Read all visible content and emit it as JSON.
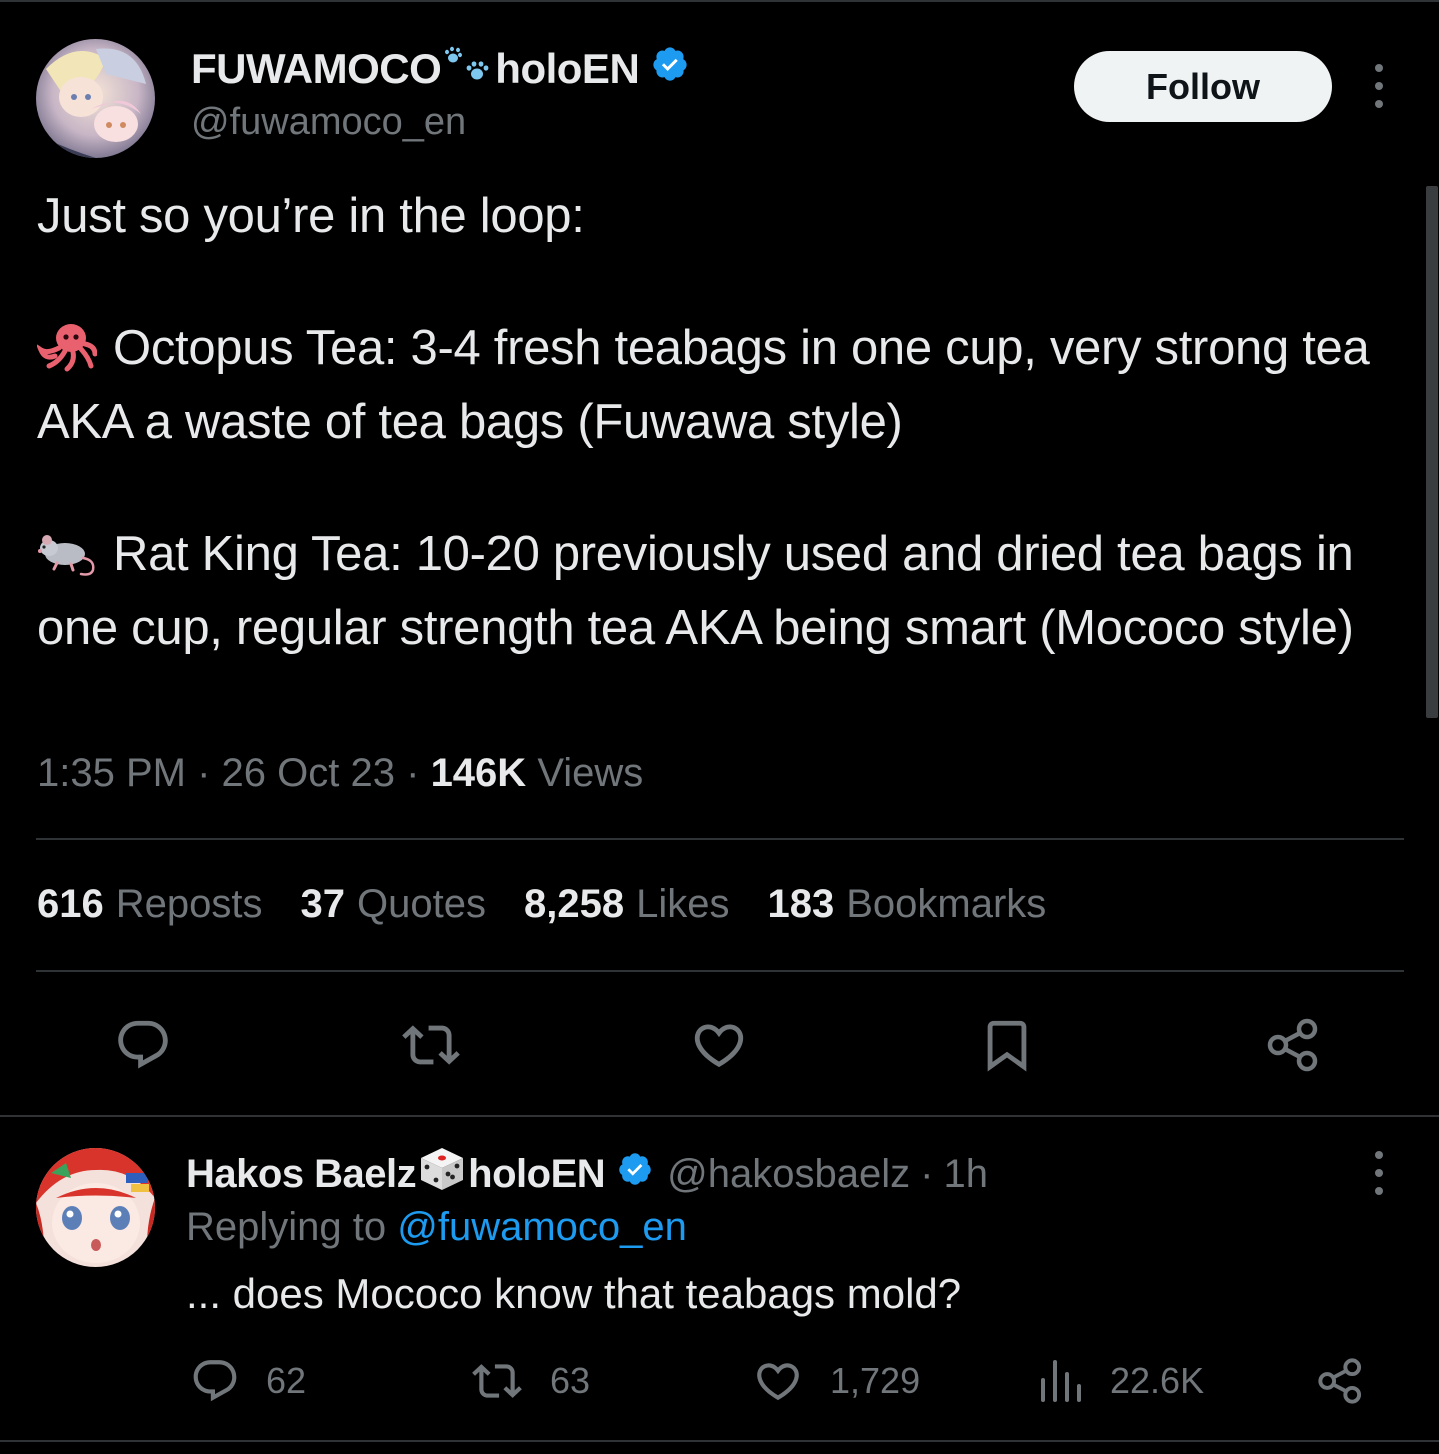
{
  "main_tweet": {
    "author": {
      "display_name_prefix": "FUWAMOCO",
      "display_name_suffix": "holoEN",
      "name_emoji": "paw-prints",
      "handle": "@fuwamoco_en",
      "verified": true
    },
    "follow_label": "Follow",
    "text": {
      "intro": "Just so you’re in the loop:",
      "octopus_line": "Octopus Tea: 3-4 fresh teabags in one cup, very strong tea AKA a waste of tea bags (Fuwawa style)",
      "rat_line": "Rat King Tea: 10-20 previously used and dried tea bags in one cup, regular strength tea AKA being smart (Mococo style)"
    },
    "meta": {
      "time": "1:35 PM",
      "sep": "·",
      "date": "26 Oct 23",
      "views_count": "146K",
      "views_label": "Views"
    },
    "stats": {
      "reposts_count": "616",
      "reposts_label": "Reposts",
      "quotes_count": "37",
      "quotes_label": "Quotes",
      "likes_count": "8,258",
      "likes_label": "Likes",
      "bookmarks_count": "183",
      "bookmarks_label": "Bookmarks"
    },
    "actions": [
      "reply-icon",
      "repost-icon",
      "like-icon",
      "bookmark-icon",
      "share-icon"
    ]
  },
  "reply": {
    "display_name_prefix": "Hakos Baelz",
    "display_name_suffix": "holoEN",
    "name_emoji": "dice",
    "handle": "@hakosbaelz",
    "sep": "·",
    "age": "1h",
    "replying_label": "Replying to",
    "replying_to": "@fuwamoco_en",
    "text": "... does Mococo know that teabags mold?",
    "stats": {
      "replies": "62",
      "reposts": "63",
      "likes": "1,729",
      "views": "22.6K"
    }
  },
  "colors": {
    "background": "#000000",
    "text_primary": "#e7e9ea",
    "text_secondary": "#71767b",
    "accent_blue": "#1d9bf0",
    "divider": "#2f3336",
    "follow_bg": "#eff3f4"
  }
}
